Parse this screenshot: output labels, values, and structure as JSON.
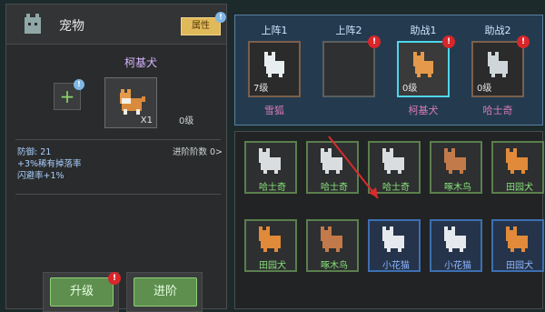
{
  "window": {
    "title": "宠物",
    "tag_button": "属性"
  },
  "badges": {
    "info": "!",
    "alert": "!"
  },
  "left": {
    "selected_pet_name": "柯基犬",
    "add_slot_symbol": "+",
    "quantity": "X1",
    "level": "0级",
    "advance_stage_label": "进阶阶数 0>",
    "stats": [
      "防御: 21",
      "+3%稀有掉落率",
      "闪避率+1%"
    ],
    "buttons": {
      "upgrade": "升级",
      "advance": "进阶"
    }
  },
  "top_slots": [
    {
      "label": "上阵1",
      "pet": "雪狐",
      "level": "7级",
      "selected": false,
      "empty": false
    },
    {
      "label": "上阵2",
      "pet": "",
      "level": "",
      "selected": false,
      "empty": true,
      "alert": true
    },
    {
      "label": "助战1",
      "pet": "柯基犬",
      "level": "0级",
      "selected": true,
      "empty": false,
      "alert": true
    },
    {
      "label": "助战2",
      "pet": "哈士奇",
      "level": "0级",
      "selected": false,
      "empty": false,
      "alert": true
    }
  ],
  "grid": [
    {
      "name": "哈士奇",
      "rarity": "green"
    },
    {
      "name": "哈士奇",
      "rarity": "green"
    },
    {
      "name": "哈士奇",
      "rarity": "green"
    },
    {
      "name": "啄木鸟",
      "rarity": "green"
    },
    {
      "name": "田园犬",
      "rarity": "green"
    },
    {
      "name": "田园犬",
      "rarity": "green"
    },
    {
      "name": "啄木鸟",
      "rarity": "green"
    },
    {
      "name": "小花猫",
      "rarity": "blue"
    },
    {
      "name": "小花猫",
      "rarity": "blue"
    },
    {
      "name": "田园犬",
      "rarity": "blue"
    }
  ],
  "colors": {
    "accent_gold": "#e0b95a",
    "alert_red": "#d8262a",
    "green_frame": "#5a7f4d",
    "blue_frame": "#3c6fb3",
    "selected_frame": "#4fd6e9"
  }
}
